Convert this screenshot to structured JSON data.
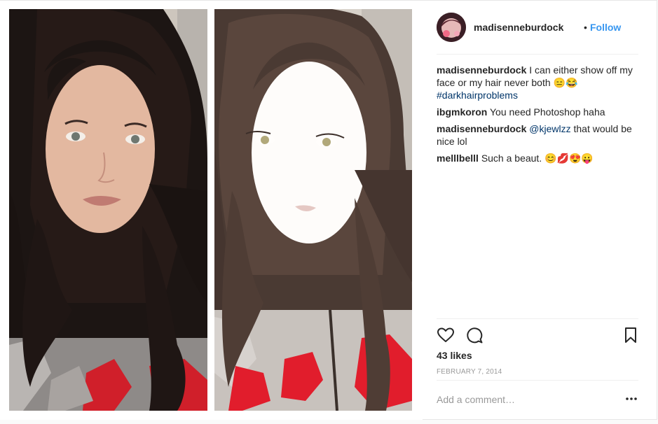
{
  "header": {
    "username": "madisenneburdock",
    "separator": "•",
    "follow_label": "Follow"
  },
  "comments": [
    {
      "user": "madisenneburdock",
      "text_before": "I can either show off my face or my hair never both 😑😂",
      "hashtag": "#darkhairproblems"
    },
    {
      "user": "ibgmkoron",
      "text": "You need Photoshop haha"
    },
    {
      "user": "madisenneburdock",
      "mention": "@kjewlzz",
      "text": "that would be nice lol"
    },
    {
      "user": "melllbelll",
      "text": "Such a beaut. 😊💋😍😛"
    }
  ],
  "footer": {
    "likes": "43 likes",
    "date": "FEBRUARY 7, 2014",
    "comment_placeholder": "Add a comment…"
  },
  "icons": {
    "like": "heart-icon",
    "comment": "comment-icon",
    "save": "bookmark-icon",
    "more": "more-options-icon"
  },
  "colors": {
    "link": "#3897f0",
    "hashtag": "#003569",
    "muted": "#999999"
  }
}
